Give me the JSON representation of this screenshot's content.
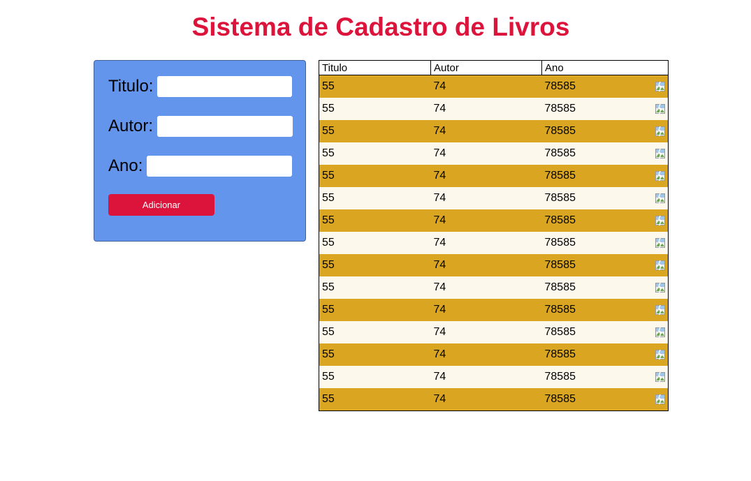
{
  "page": {
    "title": "Sistema de Cadastro de Livros"
  },
  "form": {
    "titulo_label": "Titulo:",
    "autor_label": "Autor:",
    "ano_label": "Ano:",
    "titulo_value": "",
    "autor_value": "",
    "ano_value": "",
    "add_button_label": "Adicionar"
  },
  "table": {
    "headers": [
      "Titulo",
      "Autor",
      "Ano",
      ""
    ],
    "rows": [
      {
        "titulo": "55",
        "autor": "74",
        "ano": "78585",
        "action_icon": "broken-image-icon"
      },
      {
        "titulo": "55",
        "autor": "74",
        "ano": "78585",
        "action_icon": "broken-image-icon"
      },
      {
        "titulo": "55",
        "autor": "74",
        "ano": "78585",
        "action_icon": "broken-image-icon"
      },
      {
        "titulo": "55",
        "autor": "74",
        "ano": "78585",
        "action_icon": "broken-image-icon"
      },
      {
        "titulo": "55",
        "autor": "74",
        "ano": "78585",
        "action_icon": "broken-image-icon"
      },
      {
        "titulo": "55",
        "autor": "74",
        "ano": "78585",
        "action_icon": "broken-image-icon"
      },
      {
        "titulo": "55",
        "autor": "74",
        "ano": "78585",
        "action_icon": "broken-image-icon"
      },
      {
        "titulo": "55",
        "autor": "74",
        "ano": "78585",
        "action_icon": "broken-image-icon"
      },
      {
        "titulo": "55",
        "autor": "74",
        "ano": "78585",
        "action_icon": "broken-image-icon"
      },
      {
        "titulo": "55",
        "autor": "74",
        "ano": "78585",
        "action_icon": "broken-image-icon"
      },
      {
        "titulo": "55",
        "autor": "74",
        "ano": "78585",
        "action_icon": "broken-image-icon"
      },
      {
        "titulo": "55",
        "autor": "74",
        "ano": "78585",
        "action_icon": "broken-image-icon"
      },
      {
        "titulo": "55",
        "autor": "74",
        "ano": "78585",
        "action_icon": "broken-image-icon"
      },
      {
        "titulo": "55",
        "autor": "74",
        "ano": "78585",
        "action_icon": "broken-image-icon"
      },
      {
        "titulo": "55",
        "autor": "74",
        "ano": "78585",
        "action_icon": "broken-image-icon"
      }
    ]
  },
  "colors": {
    "title": "#dc143c",
    "form_background": "#6495ed",
    "button": "#dc143c",
    "row_odd": "#daa520",
    "row_even": "#fdf8ec"
  }
}
